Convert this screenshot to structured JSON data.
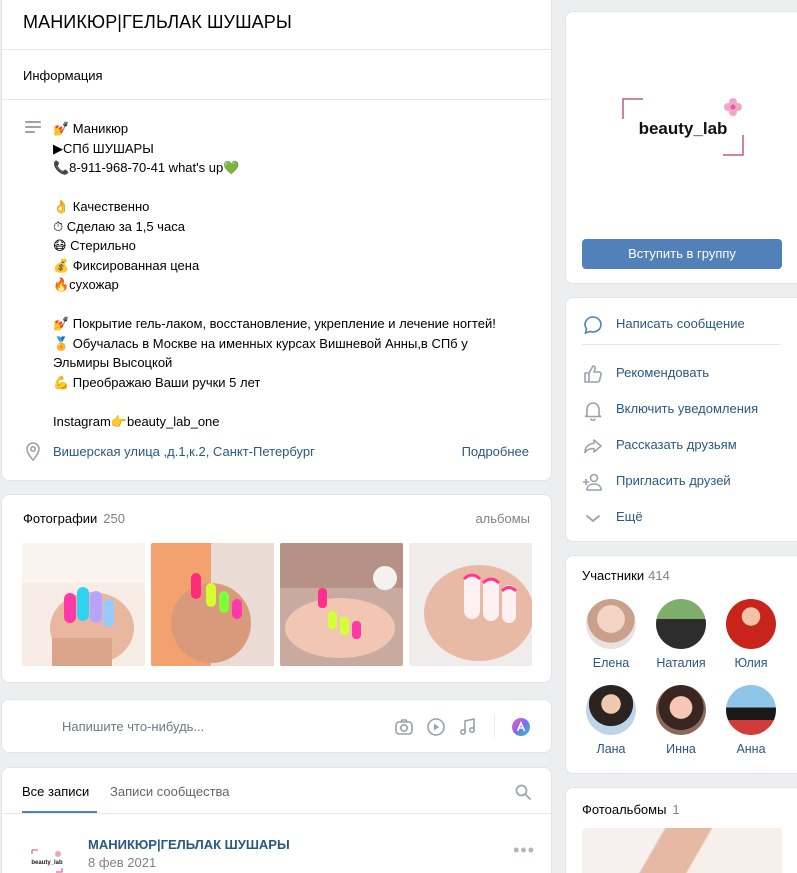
{
  "group": {
    "title": "МАНИКЮР|ГЕЛЬЛАК ШУШАРЫ",
    "info_label": "Информация",
    "description": "💅 Маникюр\n▶СПб ШУШАРЫ\n📞8-911-968-70-41 what's up💚\n\n👌 Качественно\n⏱ Сделаю за 1,5 часа\n😷 Стерильно\n💰 Фиксированная цена\n🔥сухожар\n\n💅 Покрытие гель-лаком, восстановление, укрепление и лечение ногтей!\n🏅 Обучалась в Москве на именных курсах Вишневой Анны,в СПб у Эльмиры Высоцкой\n💪 Преображаю Ваши ручки 5 лет\n\nInstagram👉beauty_lab_one",
    "address": "Вишерская улица ,д.1,к.2, Санкт-Петербург",
    "more_link": "Подробнее"
  },
  "photos": {
    "label": "Фотографии",
    "count": "250",
    "albums_link": "альбомы"
  },
  "postbox": {
    "placeholder": "Напишите что-нибудь..."
  },
  "wall": {
    "tab_all": "Все записи",
    "tab_community": "Записи сообщества",
    "post_author": "МАНИКЮР|ГЕЛЬЛАК ШУШАРЫ",
    "post_date": "8 фев 2021",
    "avatar_text": "beauty_lab"
  },
  "cover": {
    "logo_text": "beauty_lab",
    "join_button": "Вступить в группу"
  },
  "actions": {
    "write_message": "Написать сообщение",
    "recommend": "Рекомендовать",
    "notifications": "Включить уведомления",
    "tell_friends": "Рассказать друзьям",
    "invite_friends": "Пригласить друзей",
    "more": "Ещё"
  },
  "members": {
    "label": "Участники",
    "count": "414",
    "list": [
      "Елена",
      "Наталия",
      "Юлия",
      "Лана",
      "Инна",
      "Анна"
    ]
  },
  "albums": {
    "label": "Фотоальбомы",
    "count": "1"
  },
  "colors": {
    "accent": "#5181b8",
    "link": "#2a5885",
    "background": "#edeef0"
  }
}
